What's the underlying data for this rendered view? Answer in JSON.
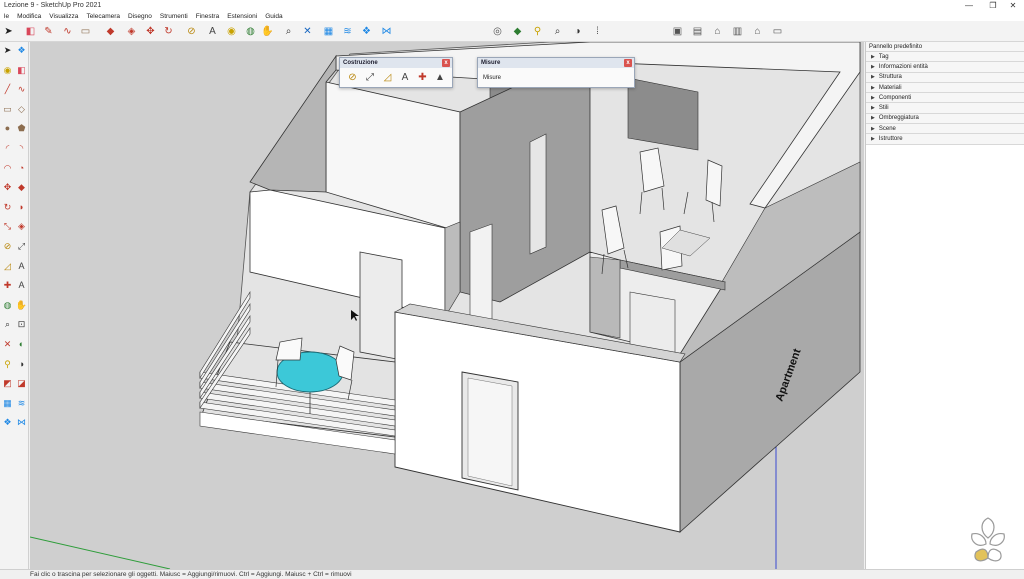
{
  "window": {
    "title": "Lezione 9 - SketchUp Pro 2021",
    "minimize": "—",
    "maximize": "❐",
    "close": "✕"
  },
  "menu": [
    "le",
    "Modifica",
    "Visualizza",
    "Telecamera",
    "Disegno",
    "Strumenti",
    "Finestra",
    "Estensioni",
    "Guida"
  ],
  "toolbar_icons": [
    {
      "name": "select-arrow-icon",
      "glyph": "➤",
      "color": "#222222"
    },
    {
      "name": "eraser-icon",
      "glyph": "◧",
      "color": "#d9475a"
    },
    {
      "name": "pencil-icon",
      "glyph": "✎",
      "color": "#c0392b"
    },
    {
      "name": "freehand-icon",
      "glyph": "∿",
      "color": "#c0392b"
    },
    {
      "name": "rectangle-icon",
      "glyph": "▭",
      "color": "#8c6d4f"
    },
    {
      "name": "push-pull-icon",
      "glyph": "◆",
      "color": "#c0392b"
    },
    {
      "name": "offset-icon",
      "glyph": "◈",
      "color": "#c0392b"
    },
    {
      "name": "move-icon",
      "glyph": "✥",
      "color": "#c0392b"
    },
    {
      "name": "rotate-icon",
      "glyph": "↻",
      "color": "#c0392b"
    },
    {
      "name": "tape-measure-icon",
      "glyph": "⊘",
      "color": "#b8860b"
    },
    {
      "name": "text-icon",
      "glyph": "A",
      "color": "#444444"
    },
    {
      "name": "paint-bucket-icon",
      "glyph": "◉",
      "color": "#c8a200"
    },
    {
      "name": "orbit-icon",
      "glyph": "◍",
      "color": "#2e7d32"
    },
    {
      "name": "pan-icon",
      "glyph": "✋",
      "color": "#c8a200"
    },
    {
      "name": "zoom-icon",
      "glyph": "⌕",
      "color": "#333333"
    },
    {
      "name": "zoom-extents-icon",
      "glyph": "✕",
      "color": "#1565c0"
    },
    {
      "name": "sandbox-icon",
      "glyph": "▦",
      "color": "#1e88e5"
    },
    {
      "name": "smoove-icon",
      "glyph": "≋",
      "color": "#1e88e5"
    },
    {
      "name": "stamp-icon",
      "glyph": "❖",
      "color": "#1e88e5"
    },
    {
      "name": "flip-edge-icon",
      "glyph": "⋈",
      "color": "#1e88e5"
    },
    {
      "name": "geo-location-icon",
      "glyph": "◎",
      "color": "#555555"
    },
    {
      "name": "warehouse-icon",
      "glyph": "◆",
      "color": "#2e7d32"
    },
    {
      "name": "walk-icon",
      "glyph": "⚲",
      "color": "#c8a200"
    },
    {
      "name": "position-camera-icon",
      "glyph": "⌕",
      "color": "#333333"
    },
    {
      "name": "look-around-icon",
      "glyph": "◑",
      "color": "#333333"
    },
    {
      "name": "footprints-icon",
      "glyph": "⁞",
      "color": "#555555"
    },
    {
      "name": "views-iso-icon",
      "glyph": "▣",
      "color": "#555555"
    },
    {
      "name": "view-top-icon",
      "glyph": "▤",
      "color": "#555555"
    },
    {
      "name": "view-front-icon",
      "glyph": "⌂",
      "color": "#555555"
    },
    {
      "name": "view-right-icon",
      "glyph": "▥",
      "color": "#555555"
    },
    {
      "name": "view-back-icon",
      "glyph": "⌂",
      "color": "#555555"
    },
    {
      "name": "view-left-icon",
      "glyph": "▭",
      "color": "#555555"
    }
  ],
  "left_icons": [
    {
      "name": "select-icon",
      "glyph": "➤",
      "color": "#222222"
    },
    {
      "name": "component-icon",
      "glyph": "❖",
      "color": "#1e88e5"
    },
    {
      "name": "paint-icon",
      "glyph": "◉",
      "color": "#c8a200"
    },
    {
      "name": "eraser-icon",
      "glyph": "◧",
      "color": "#d9475a"
    },
    {
      "name": "line-icon",
      "glyph": "╱",
      "color": "#c0392b"
    },
    {
      "name": "freehand-icon",
      "glyph": "∿",
      "color": "#c0392b"
    },
    {
      "name": "rectangle-icon",
      "glyph": "▭",
      "color": "#8c6d4f"
    },
    {
      "name": "rotated-rect-icon",
      "glyph": "◇",
      "color": "#8c6d4f"
    },
    {
      "name": "circle-icon",
      "glyph": "●",
      "color": "#8c6d4f"
    },
    {
      "name": "polygon-icon",
      "glyph": "⬟",
      "color": "#8c6d4f"
    },
    {
      "name": "arc-icon",
      "glyph": "◜",
      "color": "#c0392b"
    },
    {
      "name": "arc2-icon",
      "glyph": "◝",
      "color": "#c0392b"
    },
    {
      "name": "arc3-icon",
      "glyph": "◠",
      "color": "#c0392b"
    },
    {
      "name": "pie-icon",
      "glyph": "◔",
      "color": "#c0392b"
    },
    {
      "name": "move-icon",
      "glyph": "✥",
      "color": "#c0392b"
    },
    {
      "name": "push-pull-icon",
      "glyph": "◆",
      "color": "#c0392b"
    },
    {
      "name": "rotate-icon",
      "glyph": "↻",
      "color": "#c0392b"
    },
    {
      "name": "follow-me-icon",
      "glyph": "◗",
      "color": "#c0392b"
    },
    {
      "name": "scale-icon",
      "glyph": "⤡",
      "color": "#c0392b"
    },
    {
      "name": "offset-icon",
      "glyph": "◈",
      "color": "#c0392b"
    },
    {
      "name": "tape-icon",
      "glyph": "⊘",
      "color": "#b8860b"
    },
    {
      "name": "dimension-icon",
      "glyph": "⤢",
      "color": "#444444"
    },
    {
      "name": "protractor-icon",
      "glyph": "◿",
      "color": "#b8860b"
    },
    {
      "name": "text-icon",
      "glyph": "A",
      "color": "#444444"
    },
    {
      "name": "axes-icon",
      "glyph": "✚",
      "color": "#c0392b"
    },
    {
      "name": "3d-text-icon",
      "glyph": "A",
      "color": "#444444"
    },
    {
      "name": "orbit-icon",
      "glyph": "◍",
      "color": "#2e7d32"
    },
    {
      "name": "pan-icon",
      "glyph": "✋",
      "color": "#c8a200"
    },
    {
      "name": "zoom-icon",
      "glyph": "⌕",
      "color": "#333333"
    },
    {
      "name": "zoom-window-icon",
      "glyph": "⊡",
      "color": "#333333"
    },
    {
      "name": "zoom-extents-icon",
      "glyph": "✕",
      "color": "#c0392b"
    },
    {
      "name": "previous-icon",
      "glyph": "◐",
      "color": "#2e7d32"
    },
    {
      "name": "walk-icon",
      "glyph": "⚲",
      "color": "#c8a200"
    },
    {
      "name": "look-icon",
      "glyph": "◑",
      "color": "#333333"
    },
    {
      "name": "section-icon",
      "glyph": "◩",
      "color": "#c0392b"
    },
    {
      "name": "section2-icon",
      "glyph": "◪",
      "color": "#c0392b"
    },
    {
      "name": "sandbox-icon",
      "glyph": "▦",
      "color": "#1e88e5"
    },
    {
      "name": "smoove-icon",
      "glyph": "≋",
      "color": "#1e88e5"
    },
    {
      "name": "stamp-icon",
      "glyph": "❖",
      "color": "#1e88e5"
    },
    {
      "name": "drape-icon",
      "glyph": "⋈",
      "color": "#1e88e5"
    }
  ],
  "dialogs": {
    "costruzione": {
      "title": "Costruzione",
      "close": "x",
      "icons": [
        {
          "name": "tape-measure-icon",
          "glyph": "⊘",
          "color": "#b8860b"
        },
        {
          "name": "dimension-icon",
          "glyph": "⤢",
          "color": "#444444"
        },
        {
          "name": "protractor-icon",
          "glyph": "◿",
          "color": "#b8860b"
        },
        {
          "name": "text-icon",
          "glyph": "A",
          "color": "#444444"
        },
        {
          "name": "axes-icon",
          "glyph": "✚",
          "color": "#c0392b"
        },
        {
          "name": "3d-text-icon",
          "glyph": "▲",
          "color": "#444444"
        }
      ]
    },
    "misure": {
      "title": "Misure",
      "close": "x",
      "field_label": "Misure"
    }
  },
  "tray": {
    "title": "Pannello predefinito",
    "items": [
      "Tag",
      "Informazioni entità",
      "Struttura",
      "Materiali",
      "Componenti",
      "Stili",
      "Ombreggiatura",
      "Scene",
      "Istruttore"
    ]
  },
  "model": {
    "label": "Apartment"
  },
  "statusbar": {
    "text": "Fai clic o trascina per selezionare gli oggetti. Maiusc = Aggiungi/rimuovi. Ctrl = Aggiungi. Maiusc + Ctrl = rimuovi"
  },
  "colors": {
    "table_top": "#3cc8d8",
    "wall": "#ffffff",
    "wall_side": "#a6a6a6",
    "floor": "#e3e3e3",
    "background": "#cfcfcf",
    "axis_blue": "#3a4ad0",
    "axis_green": "#2e9d3a"
  }
}
